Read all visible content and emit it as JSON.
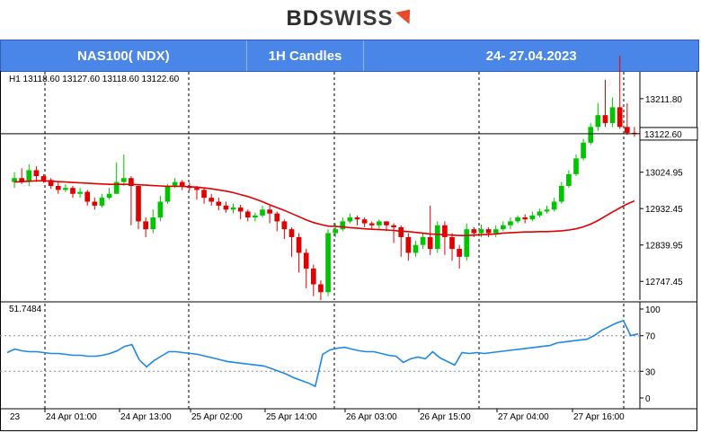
{
  "brand": {
    "logo_text_a": "BD",
    "logo_text_b": "SWISS"
  },
  "header": {
    "symbol": "NAS100( NDX)",
    "timeframe": "1H Candles",
    "date_range": "24- 27.04.2023"
  },
  "colors": {
    "header_bg": "#4a86e8",
    "bull": "#00c400",
    "bear": "#e00000",
    "ma": "#e00000",
    "rsi": "#1e88e5"
  },
  "chart_data": [
    {
      "type": "candlestick",
      "info_label": "H1  13118.60 13127.60 13118.60 13122.60",
      "current_price": 13122.6,
      "current_price_label": "13122.60",
      "ylim": [
        12700,
        13280
      ],
      "yticks": [
        13211.8,
        13024.95,
        12932.45,
        12839.95,
        12747.45
      ],
      "ytick_labels": [
        "13211.80",
        "13024.95",
        "12932.45",
        "12839.95",
        "12747.45"
      ],
      "series": [
        {
          "kind": "candles",
          "open": [
            13000,
            13010,
            13000,
            13030,
            13015,
            13005,
            12990,
            12980,
            12985,
            12970,
            12975,
            12950,
            12940,
            12960,
            12970,
            13000,
            13010,
            12990,
            12900,
            12880,
            12910,
            12950,
            12990,
            13000,
            12990,
            12985,
            12980,
            12960,
            12950,
            12940,
            12930,
            12935,
            12925,
            12910,
            12915,
            12930,
            12920,
            12900,
            12880,
            12860,
            12820,
            12780,
            12740,
            12720,
            12870,
            12880,
            12900,
            12910,
            12905,
            12895,
            12890,
            12900,
            12890,
            12885,
            12860,
            12820,
            12840,
            12860,
            12830,
            12890,
            12860,
            12830,
            12810,
            12880,
            12870,
            12880,
            12870,
            12880,
            12890,
            12900,
            12910,
            12905,
            12915,
            12925,
            12930,
            12950,
            12990,
            13020,
            13060,
            13100,
            13140,
            13170,
            13150,
            13190,
            13140,
            13125
          ],
          "close": [
            13010,
            13000,
            13030,
            13015,
            13005,
            12990,
            12980,
            12985,
            12970,
            12975,
            12950,
            12940,
            12960,
            12970,
            13000,
            13010,
            12990,
            12900,
            12880,
            12910,
            12950,
            12990,
            13000,
            12990,
            12985,
            12980,
            12960,
            12950,
            12940,
            12930,
            12935,
            12925,
            12910,
            12915,
            12930,
            12920,
            12900,
            12880,
            12860,
            12820,
            12780,
            12740,
            12720,
            12870,
            12880,
            12900,
            12910,
            12905,
            12895,
            12890,
            12900,
            12890,
            12885,
            12860,
            12820,
            12840,
            12860,
            12830,
            12890,
            12860,
            12830,
            12810,
            12880,
            12870,
            12880,
            12870,
            12880,
            12890,
            12900,
            12910,
            12905,
            12915,
            12925,
            12930,
            12950,
            12990,
            13020,
            13060,
            13100,
            13140,
            13170,
            13150,
            13190,
            13140,
            13125,
            13122.6
          ],
          "high": [
            13025,
            13035,
            13045,
            13040,
            13020,
            13010,
            13000,
            12995,
            12990,
            12985,
            12980,
            12960,
            12970,
            12985,
            13050,
            13070,
            13015,
            12990,
            12910,
            12930,
            12965,
            12995,
            13010,
            13005,
            12998,
            12990,
            12985,
            12970,
            12960,
            12950,
            12945,
            12942,
            12930,
            12922,
            12940,
            12940,
            12925,
            12905,
            12885,
            12870,
            12830,
            12790,
            12750,
            12880,
            12895,
            12910,
            12920,
            12915,
            12910,
            12900,
            12905,
            12900,
            12895,
            12890,
            12870,
            12850,
            12870,
            12940,
            12900,
            12900,
            12870,
            12840,
            12895,
            12885,
            12892,
            12885,
            12890,
            12900,
            12910,
            12915,
            12918,
            12925,
            12932,
            12940,
            12960,
            13000,
            13030,
            13070,
            13110,
            13150,
            13200,
            13260,
            13215,
            13320,
            13200,
            13140
          ],
          "low": [
            12985,
            12995,
            12990,
            13000,
            12998,
            12983,
            12970,
            12975,
            12960,
            12960,
            12940,
            12930,
            12935,
            12955,
            12990,
            12990,
            12890,
            12880,
            12860,
            12870,
            12900,
            12945,
            12985,
            12980,
            12978,
            12955,
            12945,
            12940,
            12928,
            12922,
            12920,
            12905,
            12900,
            12900,
            12910,
            12895,
            12875,
            12855,
            12810,
            12770,
            12730,
            12710,
            12700,
            12710,
            12860,
            12875,
            12895,
            12890,
            12885,
            12880,
            12880,
            12875,
            12845,
            12810,
            12800,
            12810,
            12830,
            12815,
            12820,
            12815,
            12800,
            12780,
            12800,
            12860,
            12860,
            12860,
            12860,
            12875,
            12880,
            12895,
            12895,
            12900,
            12910,
            12920,
            12925,
            12945,
            12985,
            13015,
            13055,
            13095,
            13130,
            13140,
            13140,
            13135,
            13120,
            13115
          ]
        },
        {
          "kind": "moving-average",
          "values": [
            13000,
            13001,
            13002,
            13003,
            13003,
            13002,
            13001,
            13000,
            12999,
            12998,
            12997,
            12996,
            12995,
            12994,
            12994,
            12994,
            12994,
            12993,
            12992,
            12991,
            12990,
            12989,
            12989,
            12989,
            12988,
            12987,
            12985,
            12983,
            12980,
            12977,
            12973,
            12968,
            12963,
            12957,
            12950,
            12942,
            12935,
            12928,
            12920,
            12912,
            12904,
            12897,
            12892,
            12888,
            12887,
            12886,
            12884,
            12883,
            12881,
            12880,
            12879,
            12878,
            12877,
            12875,
            12874,
            12872,
            12870,
            12868,
            12867,
            12866,
            12865,
            12864,
            12864,
            12865,
            12866,
            12867,
            12868,
            12870,
            12871,
            12872,
            12873,
            12873,
            12874,
            12874,
            12875,
            12876,
            12878,
            12881,
            12886,
            12893,
            12902,
            12913,
            12924,
            12934,
            12944,
            12952
          ]
        }
      ]
    },
    {
      "type": "line",
      "info_label": "51.7484",
      "ylim": [
        0,
        100
      ],
      "yticks": [
        100,
        70,
        30,
        0
      ],
      "ytick_labels": [
        "100",
        "70",
        "30",
        "0"
      ],
      "levels": [
        70,
        30
      ],
      "series": [
        {
          "name": "",
          "values": [
            51,
            55,
            53,
            52,
            52,
            51,
            50,
            50,
            49,
            48,
            48,
            47,
            47,
            48,
            50,
            53,
            58,
            60,
            43,
            35,
            42,
            47,
            52,
            52,
            51,
            50,
            49,
            47,
            45,
            43,
            41,
            40,
            39,
            38,
            37,
            36,
            33,
            30,
            27,
            23,
            20,
            17,
            13,
            49,
            54,
            56,
            57,
            55,
            53,
            52,
            52,
            50,
            48,
            47,
            40,
            44,
            46,
            44,
            52,
            45,
            41,
            37,
            51,
            50,
            51,
            50,
            51,
            52,
            53,
            54,
            55,
            56,
            57,
            58,
            59,
            62,
            63,
            64,
            65,
            66,
            70,
            76,
            80,
            84,
            87,
            70,
            72
          ]
        }
      ]
    }
  ],
  "x_axis": {
    "labels": [
      "23",
      "24 Apr 01:00",
      "24 Apr 13:00",
      "25 Apr 02:00",
      "25 Apr 14:00",
      "26 Apr 03:00",
      "26 Apr 15:00",
      "27 Apr 04:00",
      "27 Apr 16:00"
    ]
  }
}
